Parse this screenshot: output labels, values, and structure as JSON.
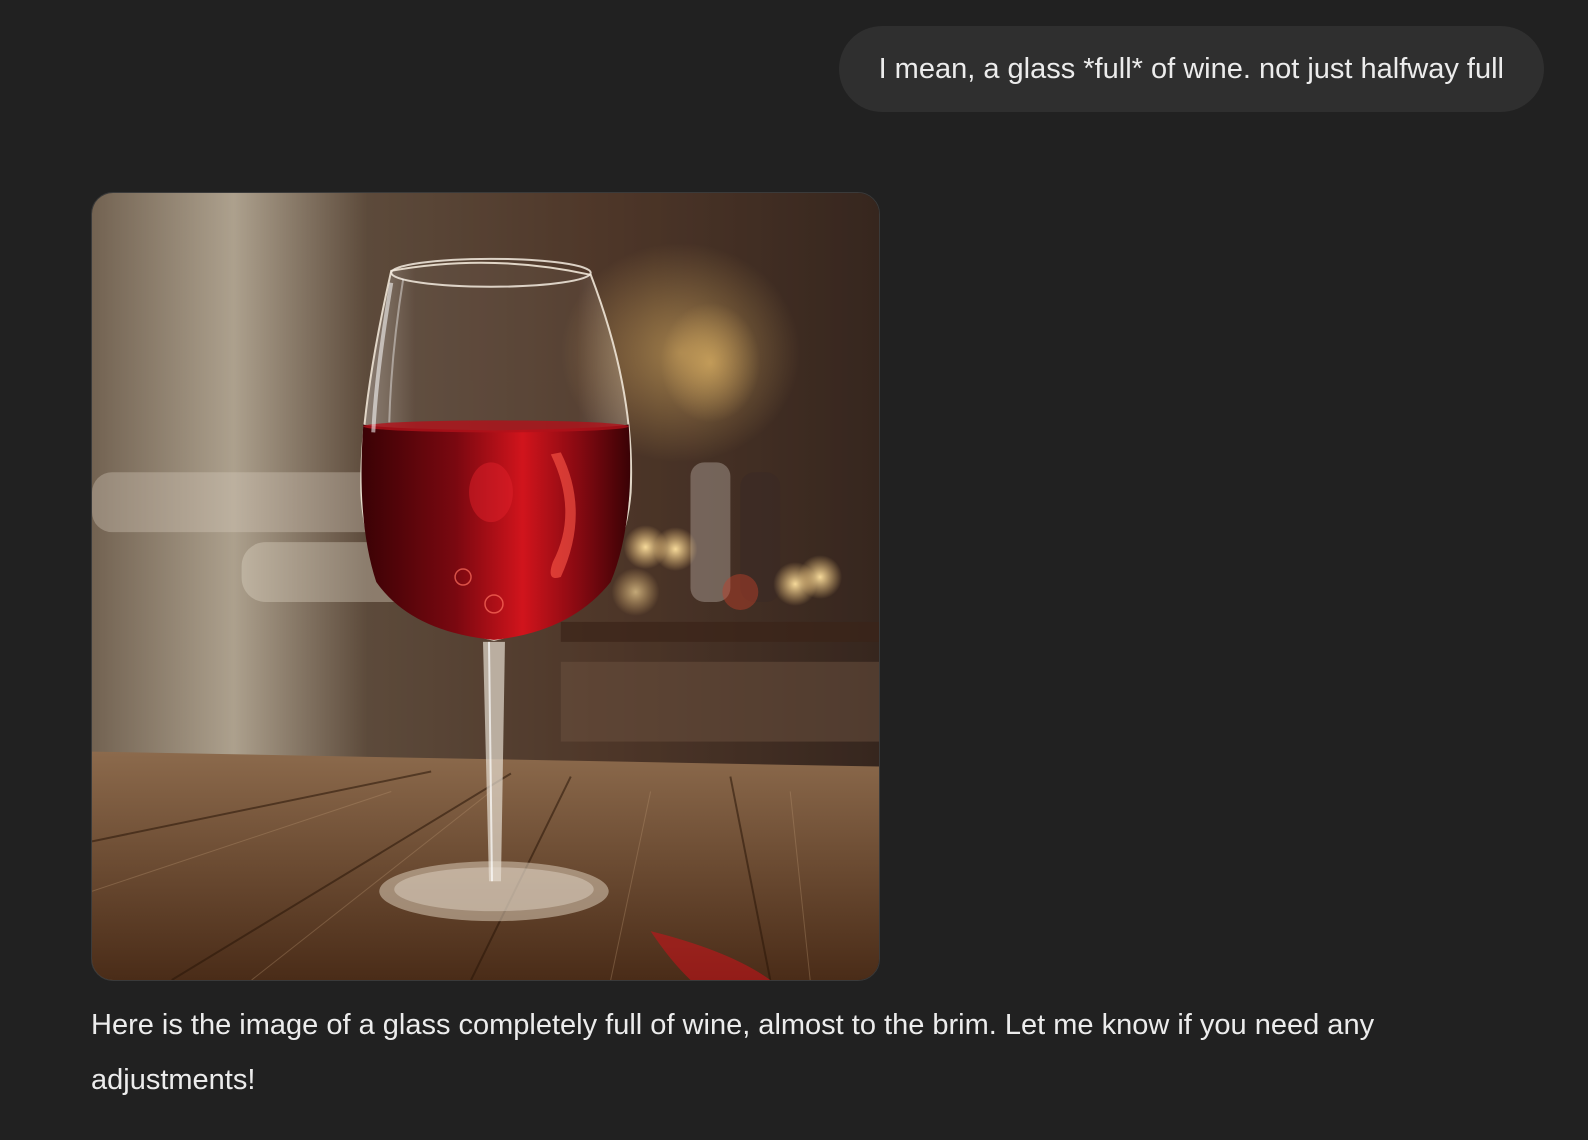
{
  "conversation": {
    "user_message": "I mean, a glass *full* of wine. not just halfway full",
    "assistant_reply": "Here is the image of a glass completely full of wine, almost to the brim. Let me know if you need any adjustments!"
  },
  "image": {
    "subject": "wine-glass-image",
    "colors": {
      "wine": "#8b0a12",
      "table": "#6b4426",
      "background": "#4a3a2e"
    }
  }
}
